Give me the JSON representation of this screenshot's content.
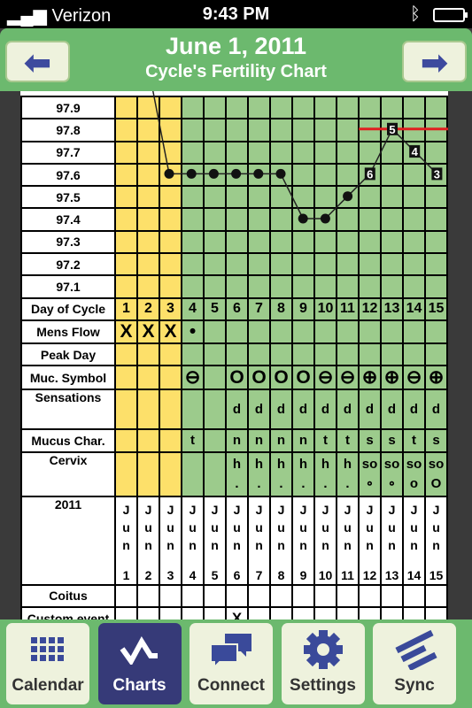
{
  "status_bar": {
    "carrier": "Verizon",
    "time": "9:43 PM"
  },
  "header": {
    "title": "June 1, 2011",
    "subtitle": "Cycle's Fertility Chart",
    "prev_icon": "arrow-left-icon",
    "next_icon": "arrow-right-icon"
  },
  "chart": {
    "temp_labels": [
      "97.9",
      "97.8",
      "97.7",
      "97.6",
      "97.5",
      "97.4",
      "97.3",
      "97.2",
      "97.1"
    ],
    "row_labels": {
      "day": "Day of Cycle",
      "flow": "Mens Flow",
      "peak": "Peak Day",
      "muc": "Muc. Symbol",
      "sens": "Sensations",
      "char": "Mucus Char.",
      "cervix": "Cervix",
      "year": "2011",
      "coitus": "Coitus",
      "custom": "Custom event"
    },
    "colors": {
      "menses": "#fde06a",
      "post": "#9ccb8c",
      "coverline": "#e02020"
    },
    "coverline": {
      "value": 97.8,
      "from_day": 12
    },
    "days": [
      {
        "day": "1",
        "flow": "X",
        "muc": "",
        "sens": "",
        "char": "",
        "cx1": "",
        "cx2": "",
        "month": "Jun",
        "date": "1",
        "custom": "",
        "temp": null,
        "label": ""
      },
      {
        "day": "2",
        "flow": "X",
        "muc": "",
        "sens": "",
        "char": "",
        "cx1": "",
        "cx2": "",
        "month": "Jun",
        "date": "2",
        "custom": "",
        "temp": null,
        "label": ""
      },
      {
        "day": "3",
        "flow": "X",
        "muc": "",
        "sens": "",
        "char": "",
        "cx1": "",
        "cx2": "",
        "month": "Jun",
        "date": "3",
        "custom": "",
        "temp": 97.6,
        "label": ""
      },
      {
        "day": "4",
        "flow": "•",
        "muc": "⊖",
        "sens": "",
        "char": "t",
        "cx1": "",
        "cx2": "",
        "month": "Jun",
        "date": "4",
        "custom": "",
        "temp": 97.6,
        "label": ""
      },
      {
        "day": "5",
        "flow": "",
        "muc": "",
        "sens": "",
        "char": "",
        "cx1": "",
        "cx2": "",
        "month": "Jun",
        "date": "5",
        "custom": "",
        "temp": 97.6,
        "label": ""
      },
      {
        "day": "6",
        "flow": "",
        "muc": "O",
        "sens": "d",
        "char": "n",
        "cx1": "h",
        "cx2": ".",
        "month": "Jun",
        "date": "6",
        "custom": "X",
        "temp": 97.6,
        "label": ""
      },
      {
        "day": "7",
        "flow": "",
        "muc": "O",
        "sens": "d",
        "char": "n",
        "cx1": "h",
        "cx2": ".",
        "month": "Jun",
        "date": "7",
        "custom": "",
        "temp": 97.6,
        "label": ""
      },
      {
        "day": "8",
        "flow": "",
        "muc": "O",
        "sens": "d",
        "char": "n",
        "cx1": "h",
        "cx2": ".",
        "month": "Jun",
        "date": "8",
        "custom": "",
        "temp": 97.6,
        "label": ""
      },
      {
        "day": "9",
        "flow": "",
        "muc": "O",
        "sens": "d",
        "char": "n",
        "cx1": "h",
        "cx2": ".",
        "month": "Jun",
        "date": "9",
        "custom": "",
        "temp": 97.4,
        "label": ""
      },
      {
        "day": "10",
        "flow": "",
        "muc": "⊖",
        "sens": "d",
        "char": "t",
        "cx1": "h",
        "cx2": ".",
        "month": "Jun",
        "date": "10",
        "custom": "",
        "temp": 97.4,
        "label": ""
      },
      {
        "day": "11",
        "flow": "",
        "muc": "⊖",
        "sens": "d",
        "char": "t",
        "cx1": "h",
        "cx2": ".",
        "month": "Jun",
        "date": "11",
        "custom": "",
        "temp": 97.5,
        "label": ""
      },
      {
        "day": "12",
        "flow": "",
        "muc": "⊕",
        "sens": "d",
        "char": "s",
        "cx1": "so",
        "cx2": "∘",
        "month": "Jun",
        "date": "12",
        "custom": "",
        "temp": 97.6,
        "label": "6"
      },
      {
        "day": "13",
        "flow": "",
        "muc": "⊕",
        "sens": "d",
        "char": "s",
        "cx1": "so",
        "cx2": "∘",
        "month": "Jun",
        "date": "13",
        "custom": "",
        "temp": 97.8,
        "label": "5"
      },
      {
        "day": "14",
        "flow": "",
        "muc": "⊖",
        "sens": "d",
        "char": "t",
        "cx1": "so",
        "cx2": "o",
        "month": "Jun",
        "date": "14",
        "custom": "",
        "temp": 97.7,
        "label": "4"
      },
      {
        "day": "15",
        "flow": "",
        "muc": "⊕",
        "sens": "d",
        "char": "s",
        "cx1": "so",
        "cx2": "O",
        "month": "Jun",
        "date": "15",
        "custom": "",
        "temp": 97.6,
        "label": "3"
      }
    ]
  },
  "tabs": [
    {
      "label": "Calendar",
      "icon": "calendar-grid-icon",
      "active": false
    },
    {
      "label": "Charts",
      "icon": "chart-line-icon",
      "active": true
    },
    {
      "label": "Connect",
      "icon": "chat-bubbles-icon",
      "active": false
    },
    {
      "label": "Settings",
      "icon": "gear-icon",
      "active": false
    },
    {
      "label": "Sync",
      "icon": "sync-icon",
      "active": false
    }
  ]
}
